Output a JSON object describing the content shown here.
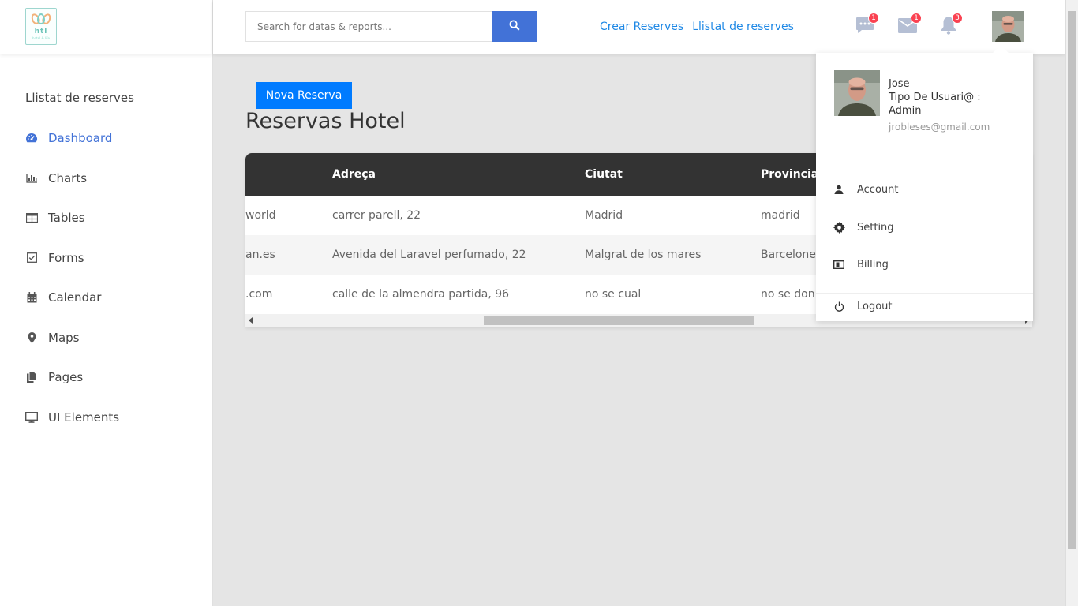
{
  "sidebar": {
    "logo_text": "htl",
    "logo_sub": "hotel & life",
    "title": "Llistat de reserves",
    "items": [
      {
        "label": "Dashboard",
        "icon": "dashboard-icon",
        "active": true
      },
      {
        "label": "Charts",
        "icon": "bar-chart-icon"
      },
      {
        "label": "Tables",
        "icon": "table-icon"
      },
      {
        "label": "Forms",
        "icon": "checkbox-icon"
      },
      {
        "label": "Calendar",
        "icon": "calendar-icon"
      },
      {
        "label": "Maps",
        "icon": "map-marker-icon"
      },
      {
        "label": "Pages",
        "icon": "pages-icon"
      },
      {
        "label": "UI Elements",
        "icon": "desktop-icon"
      }
    ]
  },
  "header": {
    "search_placeholder": "Search for datas & reports...",
    "links": [
      "Crear Reserves",
      "Llistat de reserves"
    ],
    "badges": {
      "messages": "1",
      "mail": "1",
      "notifications": "3"
    },
    "accent": "#4272d7",
    "link_color": "#1e88e5",
    "badge_color": "#fa4251"
  },
  "main": {
    "new_button": "Nova Reserva",
    "title": "Reservas Hotel",
    "table": {
      "columns": [
        "",
        "Adreça",
        "Ciutat",
        "Provincia"
      ],
      "rows": [
        [
          "world",
          "carrer parell, 22",
          "Madrid",
          "madrid"
        ],
        [
          "an.es",
          "Avenida del Laravel perfumado, 22",
          "Malgrat de los mares",
          "Barcelone"
        ],
        [
          ".com",
          "calle de la almendra partida, 96",
          "no se cual",
          "no se don"
        ]
      ]
    }
  },
  "user_menu": {
    "name": "Jose",
    "role": "Tipo De Usuari@ : Admin",
    "email": "jrobleses@gmail.com",
    "items": [
      "Account",
      "Setting",
      "Billing"
    ],
    "logout": "Logout"
  }
}
